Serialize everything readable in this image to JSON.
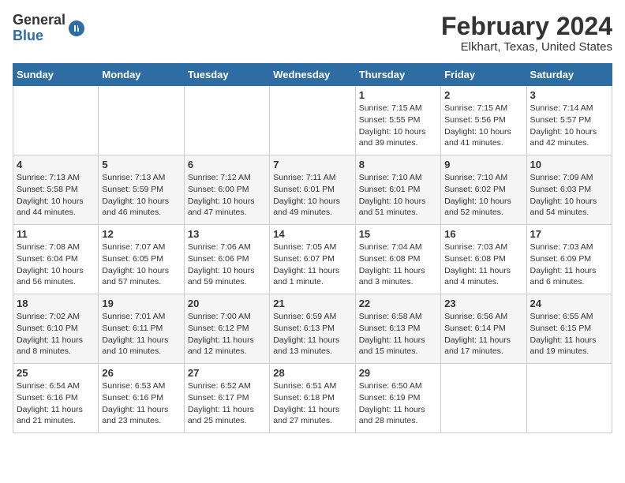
{
  "logo": {
    "general": "General",
    "blue": "Blue"
  },
  "title": "February 2024",
  "location": "Elkhart, Texas, United States",
  "days_of_week": [
    "Sunday",
    "Monday",
    "Tuesday",
    "Wednesday",
    "Thursday",
    "Friday",
    "Saturday"
  ],
  "weeks": [
    [
      {
        "day": "",
        "info": ""
      },
      {
        "day": "",
        "info": ""
      },
      {
        "day": "",
        "info": ""
      },
      {
        "day": "",
        "info": ""
      },
      {
        "day": "1",
        "info": "Sunrise: 7:15 AM\nSunset: 5:55 PM\nDaylight: 10 hours\nand 39 minutes."
      },
      {
        "day": "2",
        "info": "Sunrise: 7:15 AM\nSunset: 5:56 PM\nDaylight: 10 hours\nand 41 minutes."
      },
      {
        "day": "3",
        "info": "Sunrise: 7:14 AM\nSunset: 5:57 PM\nDaylight: 10 hours\nand 42 minutes."
      }
    ],
    [
      {
        "day": "4",
        "info": "Sunrise: 7:13 AM\nSunset: 5:58 PM\nDaylight: 10 hours\nand 44 minutes."
      },
      {
        "day": "5",
        "info": "Sunrise: 7:13 AM\nSunset: 5:59 PM\nDaylight: 10 hours\nand 46 minutes."
      },
      {
        "day": "6",
        "info": "Sunrise: 7:12 AM\nSunset: 6:00 PM\nDaylight: 10 hours\nand 47 minutes."
      },
      {
        "day": "7",
        "info": "Sunrise: 7:11 AM\nSunset: 6:01 PM\nDaylight: 10 hours\nand 49 minutes."
      },
      {
        "day": "8",
        "info": "Sunrise: 7:10 AM\nSunset: 6:01 PM\nDaylight: 10 hours\nand 51 minutes."
      },
      {
        "day": "9",
        "info": "Sunrise: 7:10 AM\nSunset: 6:02 PM\nDaylight: 10 hours\nand 52 minutes."
      },
      {
        "day": "10",
        "info": "Sunrise: 7:09 AM\nSunset: 6:03 PM\nDaylight: 10 hours\nand 54 minutes."
      }
    ],
    [
      {
        "day": "11",
        "info": "Sunrise: 7:08 AM\nSunset: 6:04 PM\nDaylight: 10 hours\nand 56 minutes."
      },
      {
        "day": "12",
        "info": "Sunrise: 7:07 AM\nSunset: 6:05 PM\nDaylight: 10 hours\nand 57 minutes."
      },
      {
        "day": "13",
        "info": "Sunrise: 7:06 AM\nSunset: 6:06 PM\nDaylight: 10 hours\nand 59 minutes."
      },
      {
        "day": "14",
        "info": "Sunrise: 7:05 AM\nSunset: 6:07 PM\nDaylight: 11 hours\nand 1 minute."
      },
      {
        "day": "15",
        "info": "Sunrise: 7:04 AM\nSunset: 6:08 PM\nDaylight: 11 hours\nand 3 minutes."
      },
      {
        "day": "16",
        "info": "Sunrise: 7:03 AM\nSunset: 6:08 PM\nDaylight: 11 hours\nand 4 minutes."
      },
      {
        "day": "17",
        "info": "Sunrise: 7:03 AM\nSunset: 6:09 PM\nDaylight: 11 hours\nand 6 minutes."
      }
    ],
    [
      {
        "day": "18",
        "info": "Sunrise: 7:02 AM\nSunset: 6:10 PM\nDaylight: 11 hours\nand 8 minutes."
      },
      {
        "day": "19",
        "info": "Sunrise: 7:01 AM\nSunset: 6:11 PM\nDaylight: 11 hours\nand 10 minutes."
      },
      {
        "day": "20",
        "info": "Sunrise: 7:00 AM\nSunset: 6:12 PM\nDaylight: 11 hours\nand 12 minutes."
      },
      {
        "day": "21",
        "info": "Sunrise: 6:59 AM\nSunset: 6:13 PM\nDaylight: 11 hours\nand 13 minutes."
      },
      {
        "day": "22",
        "info": "Sunrise: 6:58 AM\nSunset: 6:13 PM\nDaylight: 11 hours\nand 15 minutes."
      },
      {
        "day": "23",
        "info": "Sunrise: 6:56 AM\nSunset: 6:14 PM\nDaylight: 11 hours\nand 17 minutes."
      },
      {
        "day": "24",
        "info": "Sunrise: 6:55 AM\nSunset: 6:15 PM\nDaylight: 11 hours\nand 19 minutes."
      }
    ],
    [
      {
        "day": "25",
        "info": "Sunrise: 6:54 AM\nSunset: 6:16 PM\nDaylight: 11 hours\nand 21 minutes."
      },
      {
        "day": "26",
        "info": "Sunrise: 6:53 AM\nSunset: 6:16 PM\nDaylight: 11 hours\nand 23 minutes."
      },
      {
        "day": "27",
        "info": "Sunrise: 6:52 AM\nSunset: 6:17 PM\nDaylight: 11 hours\nand 25 minutes."
      },
      {
        "day": "28",
        "info": "Sunrise: 6:51 AM\nSunset: 6:18 PM\nDaylight: 11 hours\nand 27 minutes."
      },
      {
        "day": "29",
        "info": "Sunrise: 6:50 AM\nSunset: 6:19 PM\nDaylight: 11 hours\nand 28 minutes."
      },
      {
        "day": "",
        "info": ""
      },
      {
        "day": "",
        "info": ""
      }
    ]
  ]
}
